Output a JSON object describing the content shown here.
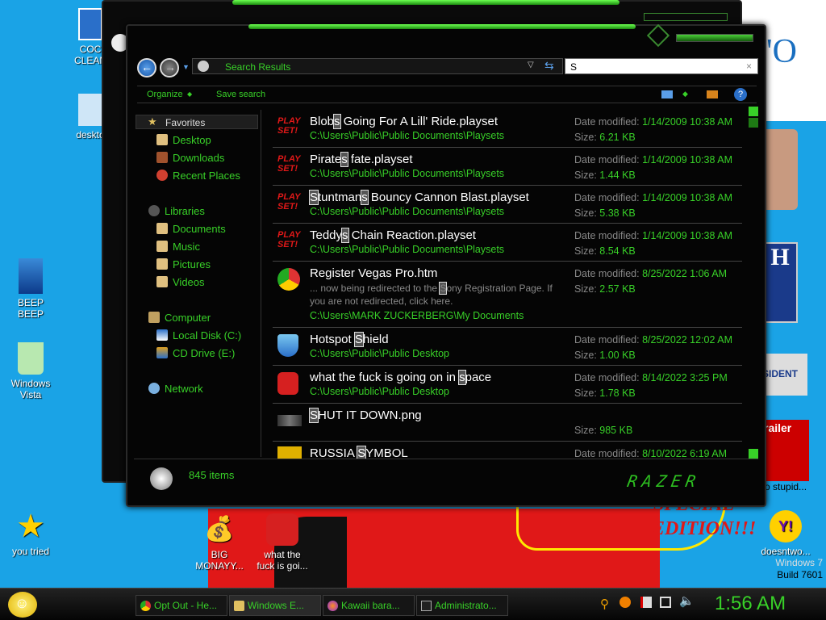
{
  "wallpaper": {
    "edition_text": "EDITION!!!",
    "special_text": "SPECIAL"
  },
  "desktop_icons": {
    "coc": "COC\nCLEAN",
    "desktop": "deskto",
    "beep": "BEEP\nBEEP",
    "recycle": "Windows\nVista",
    "star": "you tried",
    "money": "BIG\nMONAYY...",
    "angry": "what the\nfuck is goi...",
    "yahoo": "doesntwo...",
    "stupid": "o stupid...",
    "trailer": "railer",
    "president": "SIDENT"
  },
  "window": {
    "address": "Search Results",
    "search_value": "S",
    "toolbar": {
      "organize": "Organize",
      "save_search": "Save search"
    },
    "nav": {
      "favorites": "Favorites",
      "desktop": "Desktop",
      "downloads": "Downloads",
      "recent": "Recent Places",
      "libraries": "Libraries",
      "documents": "Documents",
      "music": "Music",
      "pictures": "Pictures",
      "videos": "Videos",
      "computer": "Computer",
      "local_disk": "Local Disk (C:)",
      "cd_drive": "CD Drive (E:)",
      "network": "Network"
    },
    "labels": {
      "date_modified": "Date modified:",
      "size": "Size:"
    },
    "results": [
      {
        "name_pre": "Blob",
        "name_hl": "s",
        "name_post": " Going For A Lill' Ride.playset",
        "path": "C:\\Users\\Public\\Public Documents\\Playsets",
        "date": "1/14/2009 10:38 AM",
        "size": "6.21 KB",
        "icon": "playset-icon"
      },
      {
        "name_pre": "Pirate",
        "name_hl": "s",
        "name_post": " fate.playset",
        "path": "C:\\Users\\Public\\Public Documents\\Playsets",
        "date": "1/14/2009 10:38 AM",
        "size": "1.44 KB",
        "icon": "playset-icon"
      },
      {
        "name_pre": "",
        "name_hl": "S",
        "name_post": "tuntman",
        "name_hl2": "s",
        "name_post2": " Bouncy Cannon Blast.playset",
        "path": "C:\\Users\\Public\\Public Documents\\Playsets",
        "date": "1/14/2009 10:38 AM",
        "size": "5.38 KB",
        "icon": "playset-icon"
      },
      {
        "name_pre": "Teddy",
        "name_hl": "s",
        "name_post": " Chain Reaction.playset",
        "path": "C:\\Users\\Public\\Public Documents\\Playsets",
        "date": "1/14/2009 10:38 AM",
        "size": "8.54 KB",
        "icon": "playset-icon"
      },
      {
        "name_pre": "Register Vegas Pro.htm",
        "name_hl": "",
        "name_post": "",
        "snippet_pre": "... now being redirected to the ",
        "snippet_hl": "S",
        "snippet_post": "ony Registration Page. If you are not redirected, click here.",
        "path": "C:\\Users\\MARK ZUCKERBERG\\My Documents",
        "date": "8/25/2022 1:06 AM",
        "size": "2.57 KB",
        "icon": "chrome-icon"
      },
      {
        "name_pre": "Hotspot ",
        "name_hl": "S",
        "name_post": "hield",
        "path": "C:\\Users\\Public\\Public Desktop",
        "date": "8/25/2022 12:02 AM",
        "size": "1.00 KB",
        "icon": "shield-icon"
      },
      {
        "name_pre": "what the fuck is going on in ",
        "name_hl": "s",
        "name_post": "pace",
        "path": "C:\\Users\\Public\\Public Desktop",
        "date": "8/14/2022 3:25 PM",
        "size": "1.78 KB",
        "icon": "angry-birds-icon"
      },
      {
        "name_pre": "",
        "name_hl": "S",
        "name_post": "HUT IT DOWN.png",
        "path": "",
        "date": "",
        "size": "985 KB",
        "icon": "image-icon"
      },
      {
        "name_pre": "RUSSIA ",
        "name_hl": "S",
        "name_post": "YMBOL",
        "path": "",
        "date": "8/10/2022 6:19 AM",
        "size": "",
        "icon": "folder-icon"
      }
    ],
    "status": "845 items",
    "brand": "RAZER"
  },
  "taskbar": {
    "tasks": [
      "Opt Out - He...",
      "Windows E...",
      "Kawaii bara...",
      "Administrato..."
    ],
    "clock": "1:56 AM",
    "build_line1": "Windows 7",
    "build_line2": "Build 7601"
  },
  "colors": {
    "accent": "#38d028",
    "desktop": "#1aa3e6"
  }
}
